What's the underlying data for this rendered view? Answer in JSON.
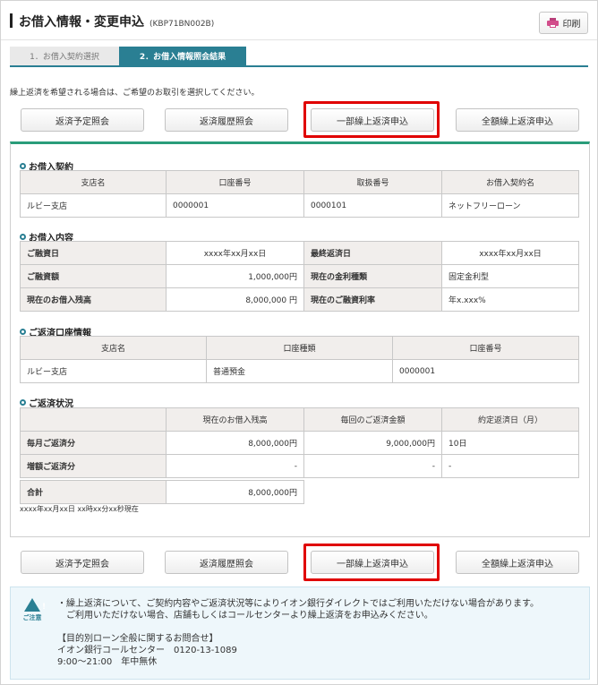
{
  "header": {
    "title": "お借入情報・変更申込",
    "code": "(KBP71BN002B)",
    "print_label": "印刷"
  },
  "steps": [
    {
      "label": "1．お借入契約選択",
      "active": false
    },
    {
      "label": "2．お借入情報照会結果",
      "active": true
    }
  ],
  "intro_text": "繰上返済を希望される場合は、ご希望のお取引を選択してください。",
  "actions": {
    "schedule": "返済予定照会",
    "history": "返済履歴照会",
    "partial": "一部繰上返済申込",
    "full": "全額繰上返済申込"
  },
  "contract": {
    "title": "お借入契約",
    "headers": [
      "支店名",
      "口座番号",
      "取扱番号",
      "お借入契約名"
    ],
    "row": [
      "ルビー支店",
      "0000001",
      "0000101",
      "ネットフリーローン"
    ]
  },
  "loan": {
    "title": "お借入内容",
    "rows": [
      {
        "label1": "ご融資日",
        "value1": "xxxx年xx月xx日",
        "label2": "最終返済日",
        "value2": "xxxx年xx月xx日"
      },
      {
        "label1": "ご融資額",
        "value1": "1,000,000円",
        "label2": "現在の金利種類",
        "value2": "固定金利型"
      },
      {
        "label1": "現在のお借入残高",
        "value1": "8,000,000 円",
        "label2": "現在のご融資利率",
        "value2": "年x.xxx%"
      }
    ]
  },
  "account": {
    "title": "ご返済口座情報",
    "headers": [
      "支店名",
      "口座種類",
      "口座番号"
    ],
    "row": [
      "ルビー支店",
      "普通預金",
      "0000001"
    ]
  },
  "status": {
    "title": "ご返済状況",
    "headers": [
      "",
      "現在のお借入残高",
      "毎回のご返済金額",
      "約定返済日（月）"
    ],
    "rows": [
      {
        "label": "毎月ご返済分",
        "balance": "8,000,000円",
        "payment": "9,000,000円",
        "day": "10日"
      },
      {
        "label": "増額ご返済分",
        "balance": "-",
        "payment": "-",
        "day": "-"
      }
    ],
    "total_label": "合計",
    "total_value": "8,000,000円",
    "as_of": "xxxx年xx月xx日 xx時xx分xx秒現在"
  },
  "caution": {
    "label": "ご注意",
    "lines": [
      "・繰上返済について、ご契約内容やご返済状況等によりイオン銀行ダイレクトではご利用いただけない場合があります。",
      "　ご利用いただけない場合、店舗もしくはコールセンターより繰上返済をお申込みください。",
      "",
      "【目的別ローン全般に関するお問合せ】",
      "イオン銀行コールセンター　0120-13-1089",
      "9:00～21:00　年中無休"
    ]
  },
  "colors": {
    "accent_teal": "#2a7f93",
    "panel_border": "#2a9d7a",
    "highlight_red": "#e00000"
  }
}
